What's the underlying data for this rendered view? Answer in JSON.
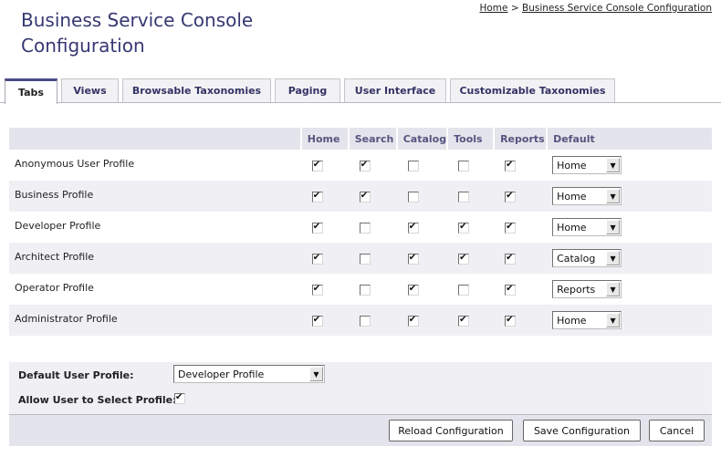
{
  "page": {
    "title": "Business Service Console Configuration"
  },
  "breadcrumb": {
    "home": "Home",
    "separator": ">",
    "current": "Business Service Console Configuration"
  },
  "tabs": [
    {
      "label": "Tabs",
      "active": true
    },
    {
      "label": "Views",
      "active": false
    },
    {
      "label": "Browsable Taxonomies",
      "active": false
    },
    {
      "label": "Paging",
      "active": false
    },
    {
      "label": "User Interface",
      "active": false
    },
    {
      "label": "Customizable Taxonomies",
      "active": false
    }
  ],
  "matrix": {
    "columns": [
      "",
      "Home",
      "Search",
      "Catalog",
      "Tools",
      "Reports",
      "Default"
    ],
    "rows": [
      {
        "name": "Anonymous User Profile",
        "checks": [
          true,
          true,
          false,
          false,
          true
        ],
        "default": "Home"
      },
      {
        "name": "Business Profile",
        "checks": [
          true,
          true,
          false,
          false,
          true
        ],
        "default": "Home"
      },
      {
        "name": "Developer Profile",
        "checks": [
          true,
          false,
          true,
          true,
          true
        ],
        "default": "Home"
      },
      {
        "name": "Architect Profile",
        "checks": [
          true,
          false,
          true,
          true,
          true
        ],
        "default": "Catalog"
      },
      {
        "name": "Operator Profile",
        "checks": [
          true,
          false,
          true,
          false,
          true
        ],
        "default": "Reports"
      },
      {
        "name": "Administrator Profile",
        "checks": [
          true,
          false,
          true,
          true,
          true
        ],
        "default": "Home"
      }
    ]
  },
  "profile": {
    "default_label": "Default User Profile:",
    "default_value": "Developer Profile",
    "allow_label": "Allow User to Select Profile:",
    "allow_checked": true
  },
  "buttons": {
    "reload": "Reload Configuration",
    "save": "Save Configuration",
    "cancel": "Cancel"
  },
  "colors": {
    "title": "#363873",
    "header_bg": "#e4e4ec",
    "alt_row_bg": "#f0f0f4",
    "tab_active_top": "#4a4a8a"
  }
}
